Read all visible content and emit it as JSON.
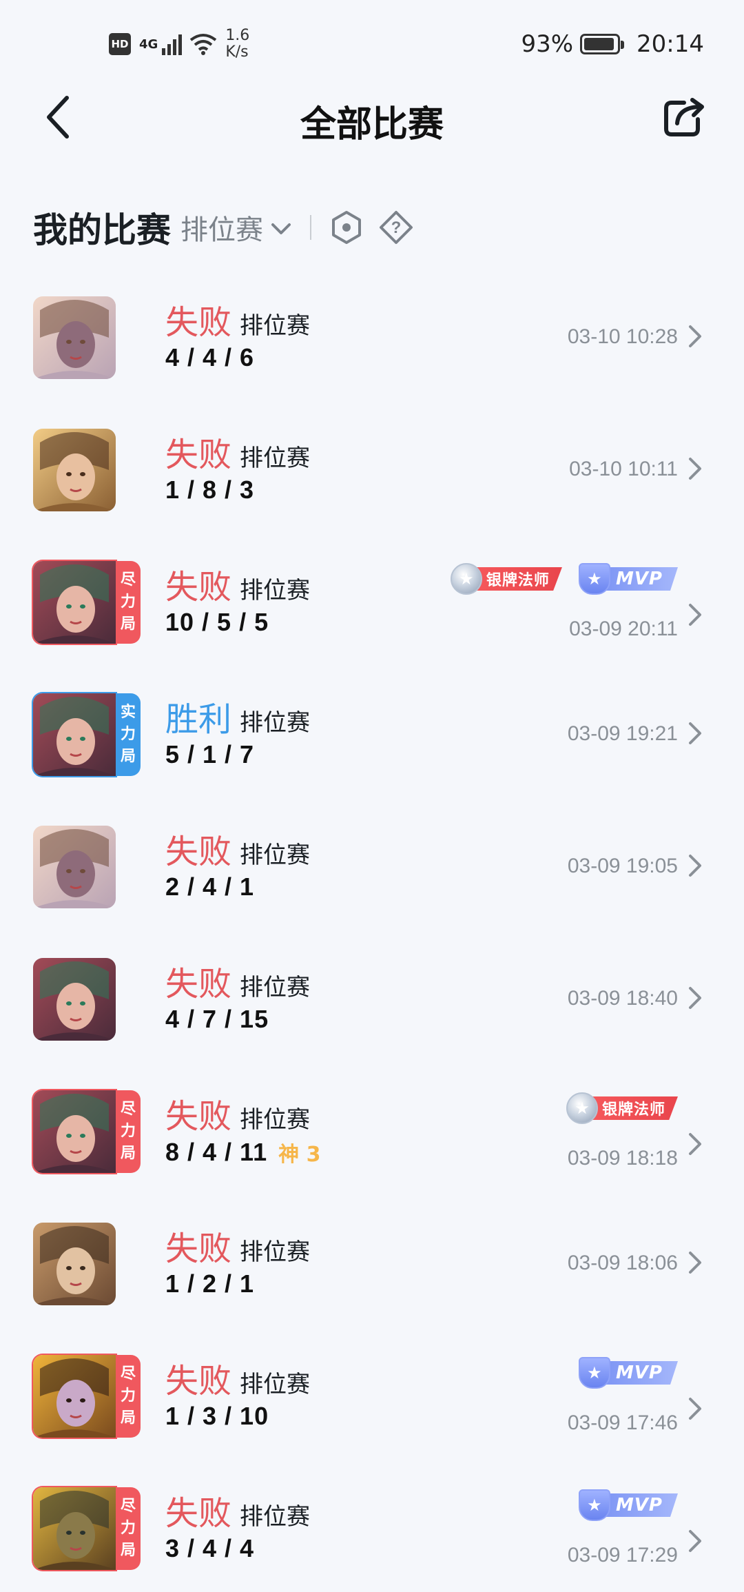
{
  "status_bar": {
    "hd": "HD",
    "network": "4G",
    "speed_value": "1.6",
    "speed_unit": "K/s",
    "battery_percent": "93%",
    "battery_level": 0.93,
    "time": "20:14"
  },
  "header": {
    "title": "全部比赛"
  },
  "section": {
    "title": "我的比赛",
    "mode_select": "排位赛"
  },
  "matches": [
    {
      "result": "失败",
      "mode": "排位赛",
      "kda": "4 / 4 / 6",
      "time": "03-10 10:28",
      "outcome": "lose",
      "hero": "silver-haired hero",
      "tag": null,
      "badges": [],
      "god": null
    },
    {
      "result": "失败",
      "mode": "排位赛",
      "kda": "1 / 8 / 3",
      "time": "03-10 10:11",
      "outcome": "lose",
      "hero": "curly-haired heroine",
      "tag": null,
      "badges": [],
      "god": null
    },
    {
      "result": "失败",
      "mode": "排位赛",
      "kda": "10 / 5 / 5",
      "time": "03-09 20:11",
      "outcome": "lose",
      "hero": "mage heroine",
      "tag": [
        "尽",
        "力",
        "局"
      ],
      "tag_color": "red",
      "badges": [
        "银牌法师",
        "MVP"
      ],
      "god": null
    },
    {
      "result": "胜利",
      "mode": "排位赛",
      "kda": "5 / 1 / 7",
      "time": "03-09 19:21",
      "outcome": "win",
      "hero": "mage heroine",
      "tag": [
        "实",
        "力",
        "局"
      ],
      "tag_color": "blue",
      "badges": [],
      "god": null
    },
    {
      "result": "失败",
      "mode": "排位赛",
      "kda": "2 / 4 / 1",
      "time": "03-09 19:05",
      "outcome": "lose",
      "hero": "silver-haired hero",
      "tag": null,
      "badges": [],
      "god": null
    },
    {
      "result": "失败",
      "mode": "排位赛",
      "kda": "4 / 7 / 15",
      "time": "03-09 18:40",
      "outcome": "lose",
      "hero": "mage heroine",
      "tag": null,
      "badges": [],
      "god": null
    },
    {
      "result": "失败",
      "mode": "排位赛",
      "kda": "8 / 4 / 11",
      "time": "03-09 18:18",
      "outcome": "lose",
      "hero": "mage heroine",
      "tag": [
        "尽",
        "力",
        "局"
      ],
      "tag_color": "red",
      "badges": [
        "银牌法师"
      ],
      "god": "神 3"
    },
    {
      "result": "失败",
      "mode": "排位赛",
      "kda": "1 / 2 / 1",
      "time": "03-09 18:06",
      "outcome": "lose",
      "hero": "eyepatch hero",
      "tag": null,
      "badges": [],
      "god": null
    },
    {
      "result": "失败",
      "mode": "排位赛",
      "kda": "1 / 3 / 10",
      "time": "03-09 17:46",
      "outcome": "lose",
      "hero": "armored warrior",
      "tag": [
        "尽",
        "力",
        "局"
      ],
      "tag_color": "red",
      "badges": [
        "MVP"
      ],
      "god": null
    },
    {
      "result": "失败",
      "mode": "排位赛",
      "kda": "3 / 4 / 4",
      "time": "03-09 17:29",
      "outcome": "lose",
      "hero": "golden mech hero",
      "tag": [
        "尽",
        "力",
        "局"
      ],
      "tag_color": "red",
      "badges": [
        "MVP"
      ],
      "god": null
    }
  ],
  "colors": {
    "lose": "#e3585d",
    "win": "#3c9be8",
    "background": "#f5f7fb",
    "tag_red": "#f0585e",
    "tag_blue": "#3c9be8",
    "god": "#f6b64a"
  },
  "icons": {
    "back": "chevron-left-icon",
    "share": "share-icon",
    "filter": "hexagon-dot-icon",
    "help": "diamond-question-icon",
    "row_arrow": "chevron-right-icon"
  }
}
